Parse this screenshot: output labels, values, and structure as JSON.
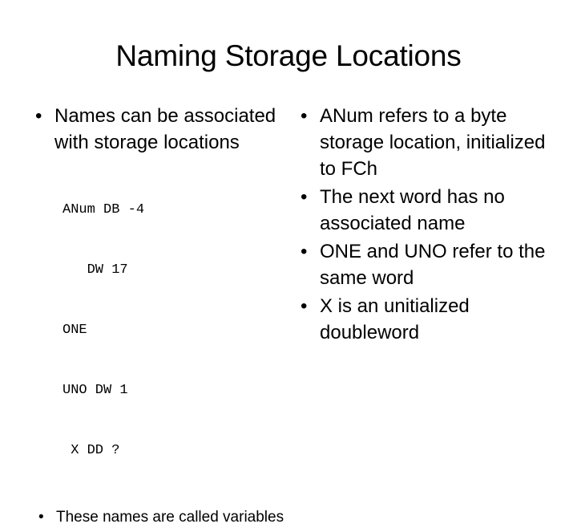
{
  "slide": {
    "title": "Naming Storage Locations",
    "background_color": "#ffffff",
    "text_color": "#000000",
    "bullet_glyph": "•"
  },
  "left_column": {
    "bullets": [
      {
        "text": "Names can be associated with storage locations"
      }
    ],
    "code_listing": {
      "lines": [
        {
          "text": "ANum DB -4"
        },
        {
          "text": "   DW 17"
        },
        {
          "text": "ONE"
        },
        {
          "text": "UNO DW 1"
        },
        {
          "text": " X DD ?"
        }
      ]
    },
    "sub_bullets": [
      {
        "text": "These names are called variables"
      }
    ]
  },
  "right_column": {
    "bullets": [
      {
        "text": "ANum refers to a byte storage location, initialized to FCh"
      },
      {
        "text": "The next word has no associated name"
      },
      {
        "text": "ONE and UNO refer to the same word"
      },
      {
        "text": "X is an unitialized doubleword"
      }
    ]
  }
}
